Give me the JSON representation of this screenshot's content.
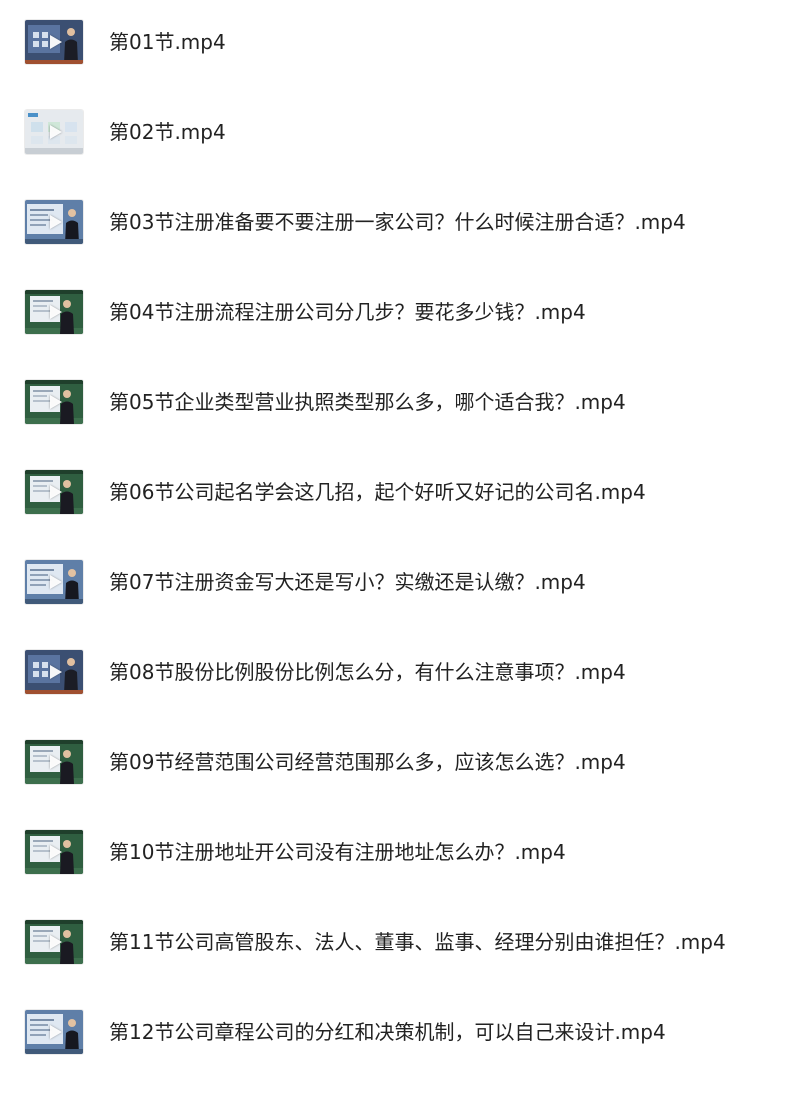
{
  "colors": {
    "text": "#222222",
    "board_green": "#3a6a4a",
    "screen_light": "#dfe6ee",
    "blue_slide": "#6f8fb7"
  },
  "files": [
    {
      "name": "第01节.mp4",
      "thumb": "dark-blue"
    },
    {
      "name": "第02节.mp4",
      "thumb": "slide-light"
    },
    {
      "name": "第03节注册准备要不要注册一家公司？什么时候注册合适？.mp4",
      "thumb": "blue-slide"
    },
    {
      "name": "第04节注册流程注册公司分几步？要花多少钱？.mp4",
      "thumb": "green-board"
    },
    {
      "name": "第05节企业类型营业执照类型那么多，哪个适合我？.mp4",
      "thumb": "green-board"
    },
    {
      "name": "第06节公司起名学会这几招，起个好听又好记的公司名.mp4",
      "thumb": "green-board"
    },
    {
      "name": "第07节注册资金写大还是写小？实缴还是认缴？.mp4",
      "thumb": "blue-slide"
    },
    {
      "name": "第08节股份比例股份比例怎么分，有什么注意事项？.mp4",
      "thumb": "dark-blue"
    },
    {
      "name": "第09节经营范围公司经营范围那么多，应该怎么选？.mp4",
      "thumb": "green-board"
    },
    {
      "name": "第10节注册地址开公司没有注册地址怎么办？.mp4",
      "thumb": "green-board"
    },
    {
      "name": "第11节公司高管股东、法人、董事、监事、经理分别由谁担任？.mp4",
      "thumb": "green-board"
    },
    {
      "name": "第12节公司章程公司的分红和决策机制，可以自己来设计.mp4",
      "thumb": "blue-slide"
    }
  ]
}
